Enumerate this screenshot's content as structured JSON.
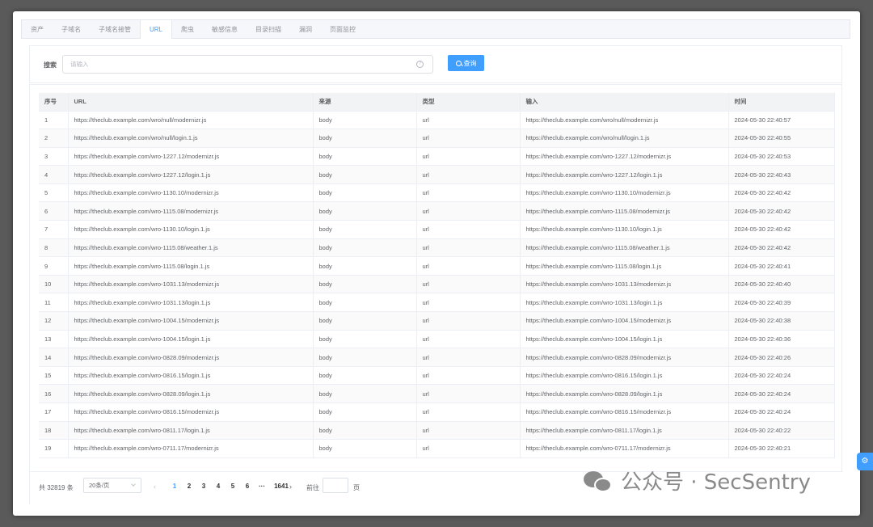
{
  "tabs": [
    {
      "label": "资产",
      "active": false
    },
    {
      "label": "子域名",
      "active": false
    },
    {
      "label": "子域名接管",
      "active": false
    },
    {
      "label": "URL",
      "active": true
    },
    {
      "label": "爬虫",
      "active": false
    },
    {
      "label": "敏感信息",
      "active": false
    },
    {
      "label": "目录扫描",
      "active": false
    },
    {
      "label": "漏洞",
      "active": false
    },
    {
      "label": "页面监控",
      "active": false
    }
  ],
  "search": {
    "label": "搜索",
    "placeholder": "请输入",
    "button_label": "查询",
    "clear_icon": "question-circle-icon",
    "button_icon": "search-icon"
  },
  "table": {
    "columns": [
      "序号",
      "URL",
      "来源",
      "类型",
      "输入",
      "时间"
    ],
    "rows": [
      [
        "1",
        "https://theclub.example.com/wro/null/modernizr.js",
        "body",
        "url",
        "https://theclub.example.com/wro/null/modernizr.js",
        "2024-05-30 22:40:57"
      ],
      [
        "2",
        "https://theclub.example.com/wro/null/login.1.js",
        "body",
        "url",
        "https://theclub.example.com/wro/null/login.1.js",
        "2024-05-30 22:40:55"
      ],
      [
        "3",
        "https://theclub.example.com/wro-1227.12/modernizr.js",
        "body",
        "url",
        "https://theclub.example.com/wro-1227.12/modernizr.js",
        "2024-05-30 22:40:53"
      ],
      [
        "4",
        "https://theclub.example.com/wro-1227.12/login.1.js",
        "body",
        "url",
        "https://theclub.example.com/wro-1227.12/login.1.js",
        "2024-05-30 22:40:43"
      ],
      [
        "5",
        "https://theclub.example.com/wro-1130.10/modernizr.js",
        "body",
        "url",
        "https://theclub.example.com/wro-1130.10/modernizr.js",
        "2024-05-30 22:40:42"
      ],
      [
        "6",
        "https://theclub.example.com/wro-1115.08/modernizr.js",
        "body",
        "url",
        "https://theclub.example.com/wro-1115.08/modernizr.js",
        "2024-05-30 22:40:42"
      ],
      [
        "7",
        "https://theclub.example.com/wro-1130.10/login.1.js",
        "body",
        "url",
        "https://theclub.example.com/wro-1130.10/login.1.js",
        "2024-05-30 22:40:42"
      ],
      [
        "8",
        "https://theclub.example.com/wro-1115.08/weather.1.js",
        "body",
        "url",
        "https://theclub.example.com/wro-1115.08/weather.1.js",
        "2024-05-30 22:40:42"
      ],
      [
        "9",
        "https://theclub.example.com/wro-1115.08/login.1.js",
        "body",
        "url",
        "https://theclub.example.com/wro-1115.08/login.1.js",
        "2024-05-30 22:40:41"
      ],
      [
        "10",
        "https://theclub.example.com/wro-1031.13/modernizr.js",
        "body",
        "url",
        "https://theclub.example.com/wro-1031.13/modernizr.js",
        "2024-05-30 22:40:40"
      ],
      [
        "11",
        "https://theclub.example.com/wro-1031.13/login.1.js",
        "body",
        "url",
        "https://theclub.example.com/wro-1031.13/login.1.js",
        "2024-05-30 22:40:39"
      ],
      [
        "12",
        "https://theclub.example.com/wro-1004.15/modernizr.js",
        "body",
        "url",
        "https://theclub.example.com/wro-1004.15/modernizr.js",
        "2024-05-30 22:40:38"
      ],
      [
        "13",
        "https://theclub.example.com/wro-1004.15/login.1.js",
        "body",
        "url",
        "https://theclub.example.com/wro-1004.15/login.1.js",
        "2024-05-30 22:40:36"
      ],
      [
        "14",
        "https://theclub.example.com/wro-0828.09/modernizr.js",
        "body",
        "url",
        "https://theclub.example.com/wro-0828.09/modernizr.js",
        "2024-05-30 22:40:26"
      ],
      [
        "15",
        "https://theclub.example.com/wro-0816.15/login.1.js",
        "body",
        "url",
        "https://theclub.example.com/wro-0816.15/login.1.js",
        "2024-05-30 22:40:24"
      ],
      [
        "16",
        "https://theclub.example.com/wro-0828.09/login.1.js",
        "body",
        "url",
        "https://theclub.example.com/wro-0828.09/login.1.js",
        "2024-05-30 22:40:24"
      ],
      [
        "17",
        "https://theclub.example.com/wro-0816.15/modernizr.js",
        "body",
        "url",
        "https://theclub.example.com/wro-0816.15/modernizr.js",
        "2024-05-30 22:40:24"
      ],
      [
        "18",
        "https://theclub.example.com/wro-0811.17/login.1.js",
        "body",
        "url",
        "https://theclub.example.com/wro-0811.17/login.1.js",
        "2024-05-30 22:40:22"
      ],
      [
        "19",
        "https://theclub.example.com/wro-0711.17/modernizr.js",
        "body",
        "url",
        "https://theclub.example.com/wro-0711.17/modernizr.js",
        "2024-05-30 22:40:21"
      ]
    ]
  },
  "pagination": {
    "total_label": "共 32819 条",
    "page_size": "20条/页",
    "prev_label": "‹",
    "next_label": "›",
    "pages": [
      "1",
      "2",
      "3",
      "4",
      "5",
      "6",
      "···",
      "1641"
    ],
    "current_page": "1",
    "goto_label": "前往",
    "goto_unit": "页"
  },
  "watermark": {
    "text": "公众号 · SecSentry",
    "icon": "wechat-icon"
  },
  "float_button_icon": "gear-icon",
  "colors": {
    "accent": "#409eff",
    "header_bg": "#f2f3f5",
    "border": "#ebeef5",
    "text": "#606266"
  }
}
